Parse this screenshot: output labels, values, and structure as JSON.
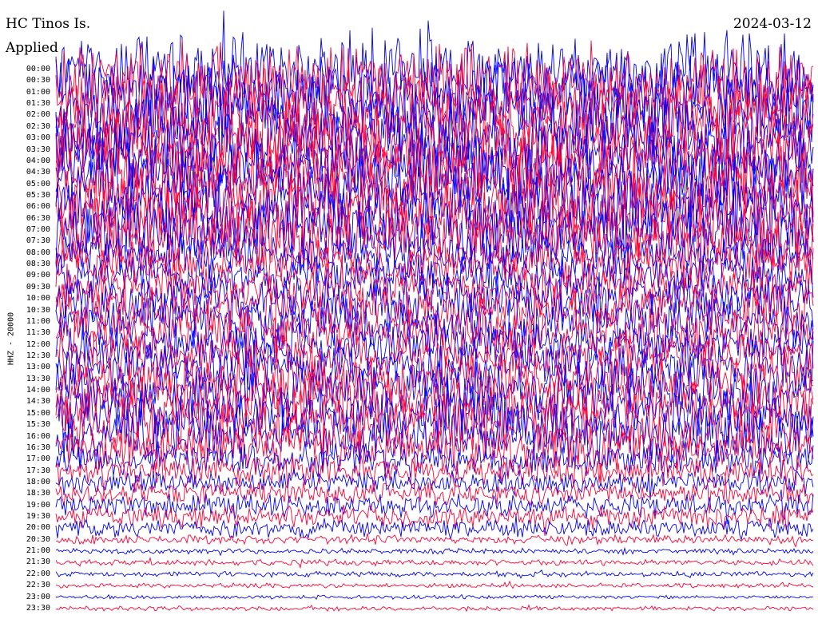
{
  "chart_data": {
    "type": "line",
    "title": "HC Tinos Is.",
    "subtitle": "Applied",
    "date": "2024-03-12",
    "ylabel": "HHZ - 20000",
    "colors": [
      "#0000ff",
      "#ff0033"
    ],
    "rows": [
      {
        "label": "00:00",
        "amplitude": 1.0
      },
      {
        "label": "00:30",
        "amplitude": 1.0
      },
      {
        "label": "01:00",
        "amplitude": 1.0
      },
      {
        "label": "01:30",
        "amplitude": 1.0
      },
      {
        "label": "02:00",
        "amplitude": 1.0
      },
      {
        "label": "02:30",
        "amplitude": 1.0
      },
      {
        "label": "03:00",
        "amplitude": 1.0
      },
      {
        "label": "03:30",
        "amplitude": 1.0
      },
      {
        "label": "04:00",
        "amplitude": 1.0
      },
      {
        "label": "04:30",
        "amplitude": 1.0
      },
      {
        "label": "05:00",
        "amplitude": 1.0
      },
      {
        "label": "05:30",
        "amplitude": 1.0
      },
      {
        "label": "06:00",
        "amplitude": 1.0
      },
      {
        "label": "06:30",
        "amplitude": 1.0
      },
      {
        "label": "07:00",
        "amplitude": 1.0
      },
      {
        "label": "07:30",
        "amplitude": 0.9
      },
      {
        "label": "08:00",
        "amplitude": 0.55
      },
      {
        "label": "08:30",
        "amplitude": 0.6
      },
      {
        "label": "09:00",
        "amplitude": 0.6
      },
      {
        "label": "09:30",
        "amplitude": 0.6
      },
      {
        "label": "10:00",
        "amplitude": 0.65
      },
      {
        "label": "10:30",
        "amplitude": 0.7
      },
      {
        "label": "11:00",
        "amplitude": 0.7
      },
      {
        "label": "11:30",
        "amplitude": 0.65
      },
      {
        "label": "12:00",
        "amplitude": 0.6
      },
      {
        "label": "12:30",
        "amplitude": 0.65
      },
      {
        "label": "13:00",
        "amplitude": 0.7
      },
      {
        "label": "13:30",
        "amplitude": 0.7
      },
      {
        "label": "14:00",
        "amplitude": 0.75
      },
      {
        "label": "14:30",
        "amplitude": 0.75
      },
      {
        "label": "15:00",
        "amplitude": 0.8
      },
      {
        "label": "15:30",
        "amplitude": 0.8
      },
      {
        "label": "16:00",
        "amplitude": 0.75
      },
      {
        "label": "16:30",
        "amplitude": 0.6
      },
      {
        "label": "17:00",
        "amplitude": 0.45
      },
      {
        "label": "17:30",
        "amplitude": 0.4
      },
      {
        "label": "18:00",
        "amplitude": 0.32
      },
      {
        "label": "18:30",
        "amplitude": 0.3
      },
      {
        "label": "19:00",
        "amplitude": 0.3
      },
      {
        "label": "19:30",
        "amplitude": 0.3
      },
      {
        "label": "20:00",
        "amplitude": 0.25
      },
      {
        "label": "20:30",
        "amplitude": 0.12
      },
      {
        "label": "21:00",
        "amplitude": 0.07
      },
      {
        "label": "21:30",
        "amplitude": 0.08
      },
      {
        "label": "22:00",
        "amplitude": 0.07
      },
      {
        "label": "22:30",
        "amplitude": 0.06
      },
      {
        "label": "23:00",
        "amplitude": 0.05
      },
      {
        "label": "23:30",
        "amplitude": 0.06
      }
    ]
  }
}
